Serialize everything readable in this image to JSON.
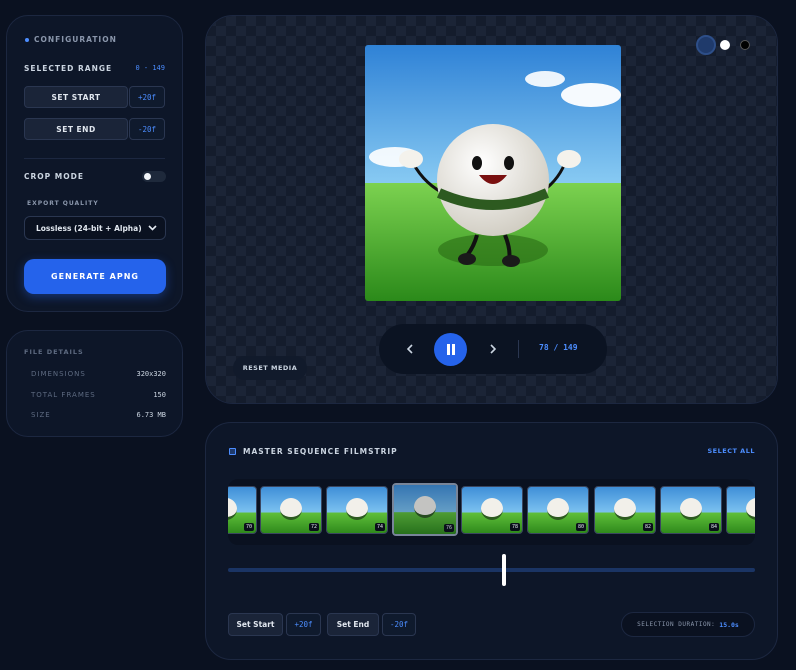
{
  "config": {
    "title": "CONFIGURATION",
    "selected_range_label": "SELECTED RANGE",
    "selected_range_value": "0 - 149",
    "set_start_label": "SET START",
    "set_start_step": "+20f",
    "set_end_label": "SET END",
    "set_end_step": "-20f",
    "crop_mode_label": "CROP MODE",
    "crop_mode_on": false,
    "export_quality_label": "EXPORT QUALITY",
    "export_quality_value": "Lossless (24-bit + Alpha)",
    "generate_label": "GENERATE APNG"
  },
  "file_details": {
    "title": "FILE DETAILS",
    "rows": [
      {
        "key": "DIMENSIONS",
        "value": "320x320"
      },
      {
        "key": "TOTAL FRAMES",
        "value": "150"
      },
      {
        "key": "SIZE",
        "value": "6.73 MB"
      }
    ]
  },
  "preview": {
    "reset_label": "RESET MEDIA",
    "frame_counter": "78 / 149",
    "prev_icon": "chevron-left-icon",
    "play_icon": "pause-icon",
    "next_icon": "chevron-right-icon",
    "background_options": [
      "#1f3a6b",
      "#ffffff",
      "#000000"
    ]
  },
  "filmstrip": {
    "title": "MASTER SEQUENCE FILMSTRIP",
    "select_all_label": "SELECT ALL",
    "frames": [
      "70",
      "72",
      "74",
      "76",
      "78",
      "80",
      "82",
      "84"
    ],
    "active_frame": "76",
    "playhead_fraction": 0.524,
    "set_start_label": "Set Start",
    "set_start_step": "+20f",
    "set_end_label": "Set End",
    "set_end_step": "-20f",
    "duration_label": "SELECTION DURATION:",
    "duration_value": "15.0s"
  },
  "colors": {
    "accent": "#2563eb",
    "accent_text": "#4c8dff",
    "background": "#0a1120"
  }
}
